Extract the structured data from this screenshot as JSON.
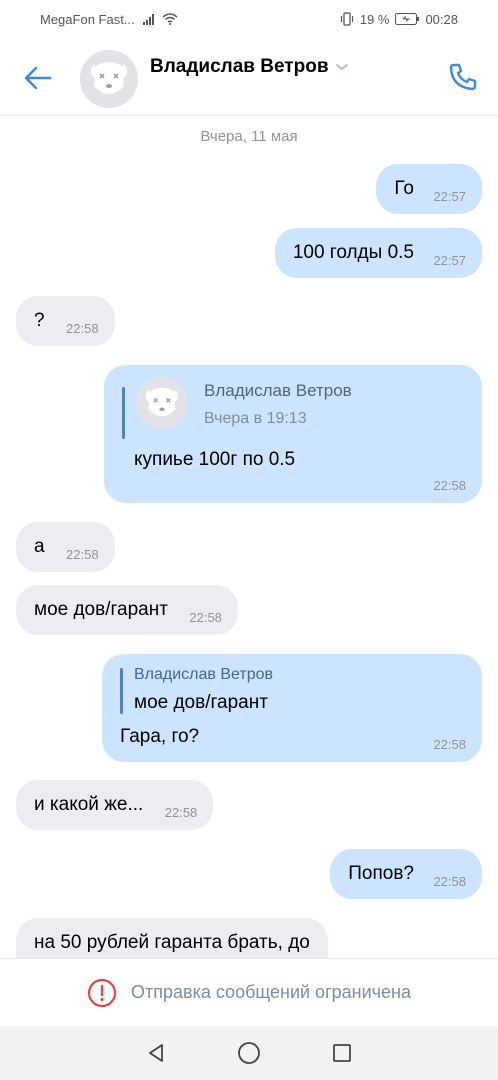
{
  "status_bar": {
    "carrier": "MegaFon Fast...",
    "battery": "19 %",
    "time": "00:28"
  },
  "header": {
    "contact_name": "Владислав Ветров",
    "icons": [
      "back-arrow-icon",
      "avatar-dog-icon",
      "chevron-down-icon",
      "phone-icon"
    ]
  },
  "chat": {
    "date_separator": "Вчера, 11 мая",
    "messages": [
      {
        "dir": "out",
        "text": "Го",
        "time": "22:57"
      },
      {
        "dir": "out",
        "text": "100 голды 0.5",
        "time": "22:57"
      },
      {
        "dir": "in",
        "text": "?",
        "time": "22:58"
      },
      {
        "dir": "out",
        "forward_author": "Владислав Ветров",
        "forward_time": "Вчера в 19:13",
        "text": "купиье 100г по 0.5",
        "time": "22:58"
      },
      {
        "dir": "in",
        "text": "а",
        "time": "22:58"
      },
      {
        "dir": "in",
        "text": "мое дов/гарант",
        "time": "22:58"
      },
      {
        "dir": "out",
        "reply_author": "Владислав Ветров",
        "reply_text": "мое дов/гарант",
        "text": "Гара, го?",
        "time": "22:58"
      },
      {
        "dir": "in",
        "text": "и какой же...",
        "time": "22:58"
      },
      {
        "dir": "out",
        "text": "Попов?",
        "time": "22:58"
      },
      {
        "dir": "in",
        "text": "на 50 рублей гаранта брать, до",
        "time": ""
      }
    ]
  },
  "footer": {
    "restricted_text": "Отправка сообщений ограничена",
    "restricted_icon": "warning-circle-icon",
    "accent_color": "#e64646"
  },
  "nav": {
    "icons": [
      "back-triangle-icon",
      "home-circle-icon",
      "recents-square-icon"
    ]
  },
  "colors": {
    "outgoing_bubble": "#cce4ff",
    "incoming_bubble": "#ebedf0",
    "accent": "#3f8ae0"
  }
}
